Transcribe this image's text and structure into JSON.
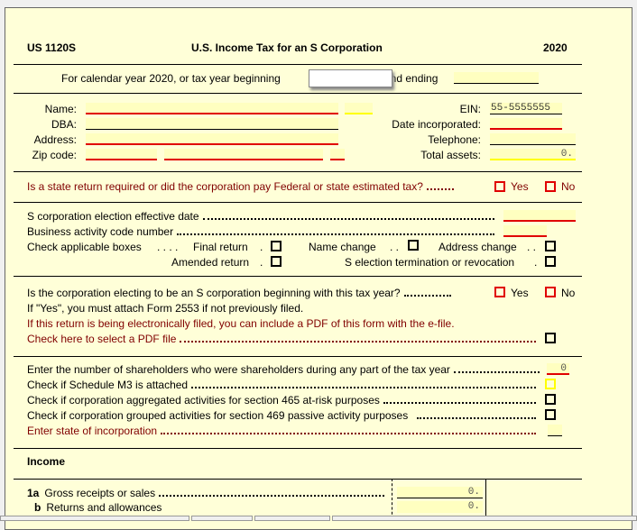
{
  "header": {
    "form_id": "US 1120S",
    "title": "U.S. Income Tax for an S Corporation",
    "year": "2020"
  },
  "tax_year": {
    "label": "For calendar year 2020,  or tax year beginning",
    "beginning_value": "",
    "and_ending_label": "and ending",
    "ending_value": ""
  },
  "entity": {
    "name_label": "Name:",
    "dba_label": "DBA:",
    "address_label": "Address:",
    "zip_label": "Zip code:",
    "ein_label": "EIN:",
    "ein_value": "55-5555555",
    "date_incorporated_label": "Date incorporated:",
    "telephone_label": "Telephone:",
    "total_assets_label": "Total assets:",
    "total_assets_value": "0."
  },
  "state_return": {
    "question": "Is a state return required or did the corporation pay Federal or state estimated tax?",
    "yes": "Yes",
    "no": "No"
  },
  "election": {
    "effective_date_label": "S corporation election effective date",
    "business_code_label": "Business activity code number",
    "check_boxes_label": "Check applicable boxes",
    "final_return": "Final return",
    "name_change": "Name change",
    "address_change": "Address change",
    "amended_return": "Amended return",
    "s_election_termination": "S election termination or revocation"
  },
  "electing": {
    "question": "Is the corporation electing to be an S corporation beginning with this tax year?",
    "yes": "Yes",
    "no": "No",
    "note": "If  \"Yes\",  you must attach Form 2553 if not previously filed.",
    "efile_note": "If this return is being electronically filed,  you can include a PDF of this form with the e-file.",
    "pdf_label": "Check here to select a PDF file"
  },
  "shareholders": {
    "count_label": "Enter the number of shareholders who were shareholders during any part of the tax year",
    "count_value": "0",
    "m3_label": "Check if Schedule M3 is attached",
    "sec465_label": "Check if corporation aggregated activities for section 465 at-risk purposes",
    "sec469_label": "Check if corporation grouped activities for section 469 passive activity purposes",
    "state_label": "Enter state of incorporation"
  },
  "income": {
    "heading": "Income",
    "lines": [
      {
        "num": "1a",
        "label": "Gross receipts or sales",
        "value": "0."
      },
      {
        "num": "b",
        "label": "Returns and allowances",
        "value": "0."
      }
    ]
  },
  "colors": {
    "background": "#ffffd8",
    "required": "#e00000",
    "label_red": "#800000",
    "field": "#ffffc0"
  }
}
